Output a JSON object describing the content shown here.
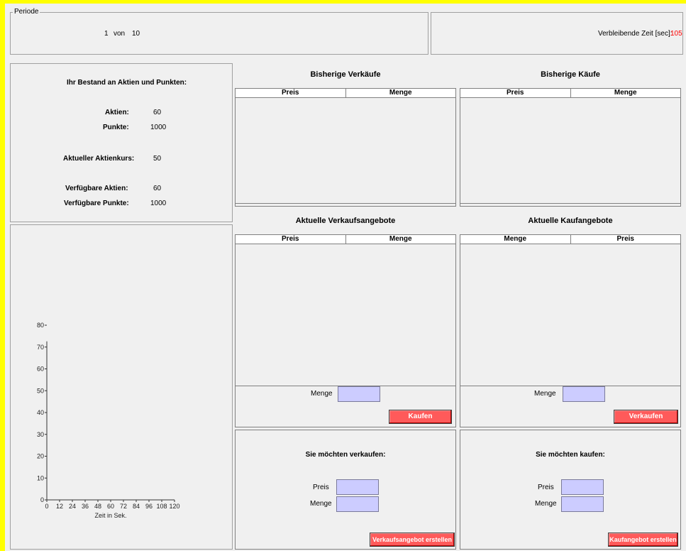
{
  "periode": {
    "legend": "Periode",
    "current": "1",
    "sep": "von",
    "total": "10",
    "remaining_label": "Verbleibende Zeit [sec]:",
    "remaining_value": "105"
  },
  "bestand": {
    "title": "Ihr Bestand an Aktien und Punkten:",
    "aktien_label": "Aktien:",
    "aktien_value": "60",
    "punkte_label": "Punkte:",
    "punkte_value": "1000",
    "kurs_label": "Aktueller Aktienkurs:",
    "kurs_value": "50",
    "verf_aktien_label": "Verfügbare Aktien:",
    "verf_aktien_value": "60",
    "verf_punkte_label": "Verfügbare Punkte:",
    "verf_punkte_value": "1000"
  },
  "sales": {
    "title": "Bisherige Verkäufe",
    "col1": "Preis",
    "col2": "Menge"
  },
  "purchases": {
    "title": "Bisherige Käufe",
    "col1": "Preis",
    "col2": "Menge"
  },
  "sell_offers": {
    "title": "Aktuelle Verkaufsangebote",
    "col1": "Preis",
    "col2": "Menge",
    "menge_label": "Menge",
    "button": "Kaufen"
  },
  "buy_offers": {
    "title": "Aktuelle Kaufangebote",
    "col1": "Menge",
    "col2": "Preis",
    "menge_label": "Menge",
    "button": "Verkaufen"
  },
  "create_sell": {
    "title": "Sie möchten verkaufen:",
    "preis_label": "Preis",
    "menge_label": "Menge",
    "button": "Verkaufsangebot erstellen"
  },
  "create_buy": {
    "title": "Sie möchten kaufen:",
    "preis_label": "Preis",
    "menge_label": "Menge",
    "button": "Kaufangebot erstellen"
  },
  "chart_data": {
    "type": "line",
    "xlabel": "Zeit in Sek.",
    "ylabel": "",
    "x_ticks": [
      "0",
      "12",
      "24",
      "36",
      "48",
      "60",
      "72",
      "84",
      "96",
      "108",
      "120"
    ],
    "y_ticks": [
      "0",
      "10",
      "20",
      "30",
      "40",
      "50",
      "60",
      "70",
      "80"
    ],
    "xlim": [
      0,
      120
    ],
    "ylim": [
      0,
      80
    ],
    "series": []
  }
}
